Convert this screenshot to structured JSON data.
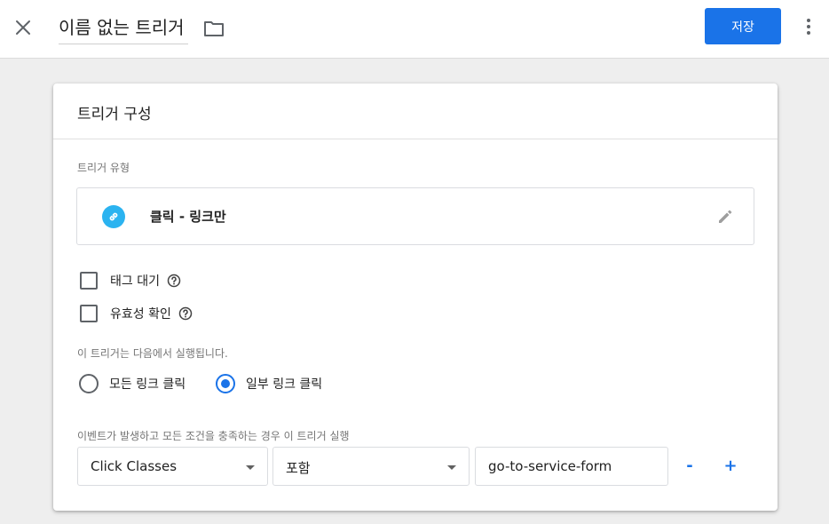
{
  "topbar": {
    "title": "이름 없는 트리거",
    "save_label": "저장",
    "icons": {
      "close": "close-icon",
      "folder": "folder-icon",
      "more": "more-vert-icon"
    }
  },
  "card": {
    "title": "트리거 구성",
    "trigger_type_label": "트리거 유형",
    "trigger_type": {
      "name": "클릭 - 링크만",
      "icon": "link-icon",
      "icon_color": "#2bb3f0"
    },
    "checkboxes": [
      {
        "label": "태그 대기",
        "checked": false
      },
      {
        "label": "유효성 확인",
        "checked": false
      }
    ],
    "fires_on_label": "이 트리거는 다음에서 실행됩니다.",
    "fires_on_options": [
      {
        "label": "모든 링크 클릭",
        "selected": false
      },
      {
        "label": "일부 링크 클릭",
        "selected": true
      }
    ],
    "condition_label": "이벤트가 발생하고 모든 조건을 충족하는 경우 이 트리거 실행",
    "condition": {
      "variable": "Click Classes",
      "operator": "포함",
      "value": "go-to-service-form",
      "remove_label": "-",
      "add_label": "+"
    }
  },
  "colors": {
    "accent": "#1a73e8",
    "background": "#eeeeee"
  }
}
